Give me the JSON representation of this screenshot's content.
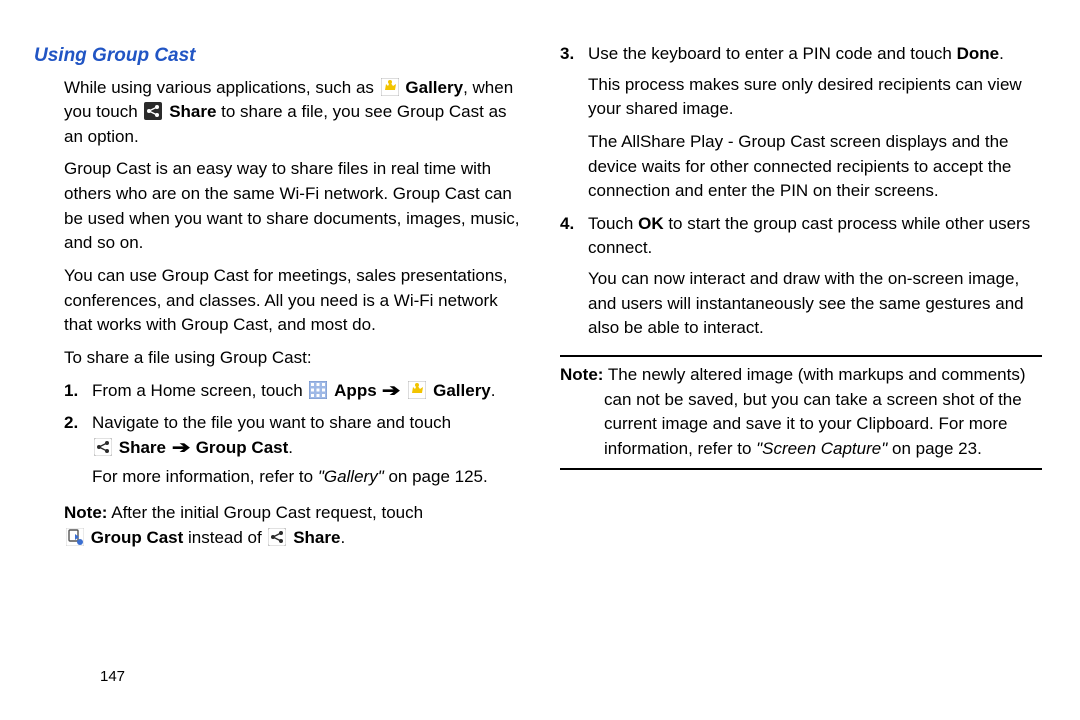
{
  "heading": "Using Group Cast",
  "left": {
    "p1a": "While using various applications, such as ",
    "p1b": "Gallery",
    "p1c": ", when you touch ",
    "p1d": "Share",
    "p1e": " to share a file, you see Group Cast as an option.",
    "p2": "Group Cast is an easy way to share files in real time with others who are on the same Wi-Fi network. Group Cast can be used when you want to share documents, images, music, and so on.",
    "p3": "You can use Group Cast for meetings, sales presentations, conferences, and classes. All you need is a Wi-Fi network that works with Group Cast, and most do.",
    "p4": "To share a file using Group Cast:",
    "step1a": "From a Home screen, touch ",
    "step1b": "Apps",
    "step1c": "Gallery",
    "step2a": "Navigate to the file you want to share and touch ",
    "step2b": "Share",
    "step2c": "Group Cast",
    "step2ref1": "For more information, refer to ",
    "step2ref2": "\"Gallery\"",
    "step2ref3": " on page 125.",
    "noteAa": "Note:",
    "noteAb": " After the initial Group Cast request, touch ",
    "noteAc": "Group Cast",
    "noteAd": " instead of ",
    "noteAe": "Share"
  },
  "right": {
    "step3a": "Use the keyboard to enter a PIN code and touch ",
    "step3b": "Done",
    "step3c": "This process makes sure only desired recipients can view your shared image.",
    "step3d": "The AllShare Play - Group Cast screen displays and the device waits for other connected recipients to accept the connection and enter the PIN on their screens.",
    "step4a": "Touch ",
    "step4b": "OK",
    "step4c": " to start the group cast process while other users connect.",
    "step4d": "You can now interact and draw with the on-screen image, and users will instantaneously see the same gestures and also be able to interact.",
    "noteBa": "Note:",
    "noteBb": " The newly altered image (with markups and comments) can not be saved, but you can take a screen shot of the current image and save it to your Clipboard. For more information, refer to ",
    "noteBc": "\"Screen Capture\"",
    "noteBd": " on page 23."
  },
  "pagenum": "147",
  "nums": {
    "n1": "1.",
    "n2": "2.",
    "n3": "3.",
    "n4": "4."
  },
  "arrow": "➔",
  "period": "."
}
